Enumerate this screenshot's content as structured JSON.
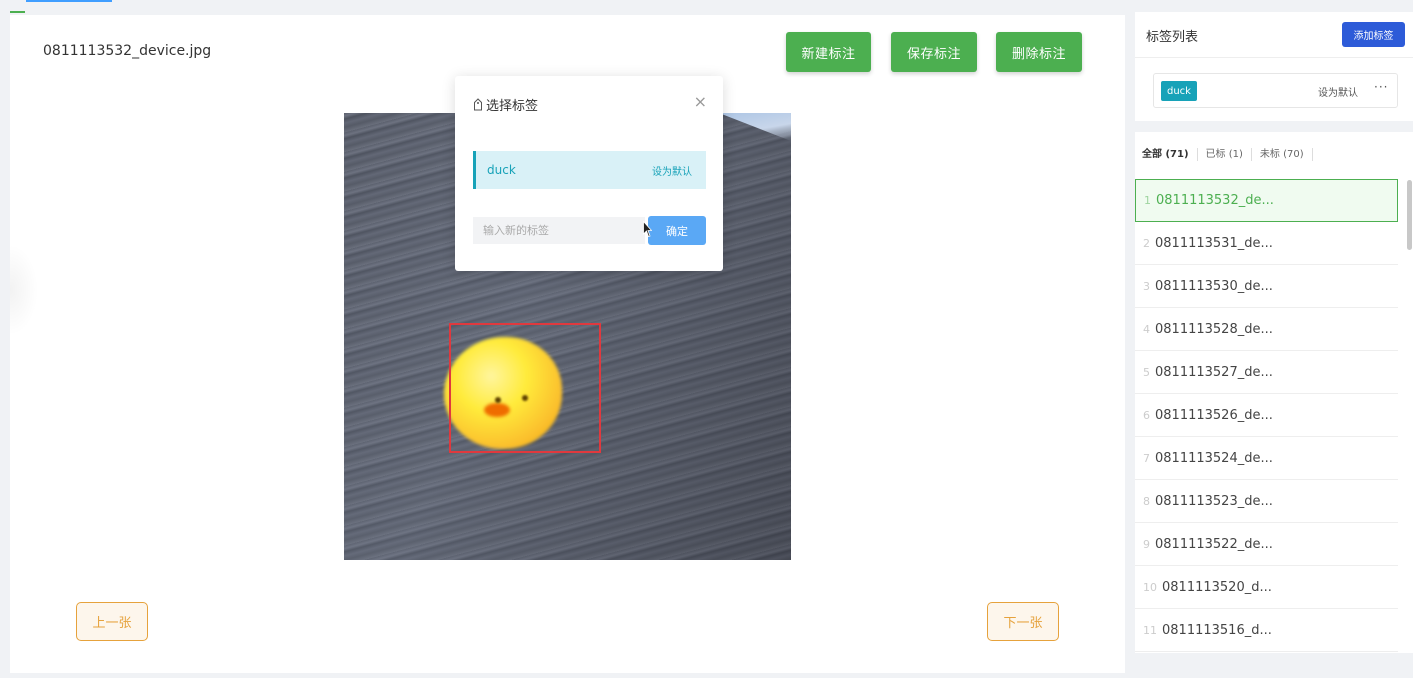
{
  "image": {
    "filename": "0811113532_device.jpg"
  },
  "toolbar": {
    "new_label": "新建标注",
    "save_label": "保存标注",
    "delete_label": "删除标注"
  },
  "navigation": {
    "prev_label": "上一张",
    "next_label": "下一张"
  },
  "dialog": {
    "title": "选择标签",
    "close_icon": "×",
    "tag_name": "duck",
    "set_default": "设为默认",
    "input_placeholder": "输入新的标签",
    "confirm_label": "确定"
  },
  "tag_panel": {
    "title": "标签列表",
    "add_label": "添加标签",
    "tag_name": "duck",
    "set_default": "设为默认",
    "more_icon": "···"
  },
  "filters": [
    {
      "label": "全部 (71)"
    },
    {
      "label": "已标 (1)"
    },
    {
      "label": "未标 (70)"
    }
  ],
  "files": [
    {
      "idx": "1",
      "name": "0811113532_de..."
    },
    {
      "idx": "2",
      "name": "0811113531_de..."
    },
    {
      "idx": "3",
      "name": "0811113530_de..."
    },
    {
      "idx": "4",
      "name": "0811113528_de..."
    },
    {
      "idx": "5",
      "name": "0811113527_de..."
    },
    {
      "idx": "6",
      "name": "0811113526_de..."
    },
    {
      "idx": "7",
      "name": "0811113524_de..."
    },
    {
      "idx": "8",
      "name": "0811113523_de..."
    },
    {
      "idx": "9",
      "name": "0811113522_de..."
    },
    {
      "idx": "10",
      "name": "0811113520_d..."
    },
    {
      "idx": "11",
      "name": "0811113516_d..."
    }
  ],
  "colors": {
    "primary_green": "#4caf50",
    "tag_cyan": "#17a2b8",
    "add_button_blue": "#2d5bd8",
    "bbox_red": "#e0393e",
    "nav_orange": "#e6a23c"
  }
}
